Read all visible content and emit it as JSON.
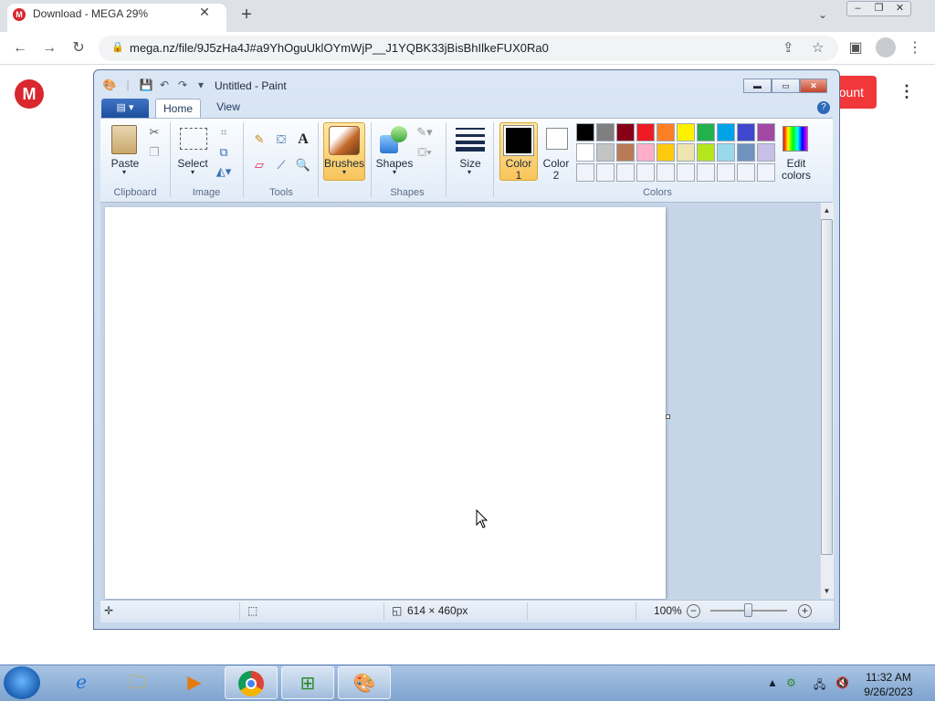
{
  "browser": {
    "tab_title": "Download - MEGA 29%",
    "favicon_letter": "M",
    "tab_close": "✕",
    "new_tab": "+",
    "url": "mega.nz/file/9J5zHa4J#a9YhOguUklOYmWjP__J1YQBK33jBisBhIlkeFUX0Ra0",
    "window_controls": [
      "–",
      "❐",
      "✕"
    ]
  },
  "mega": {
    "logo_letter": "M",
    "account_button": "ount",
    "menu": "⋮",
    "brand_color": "#d9272e"
  },
  "paint": {
    "title": "Untitled - Paint",
    "ribbon_tabs": [
      "Home",
      "View"
    ],
    "groups": {
      "clipboard": "Clipboard",
      "image": "Image",
      "tools": "Tools",
      "shapes": "Shapes",
      "colors": "Colors"
    },
    "buttons": {
      "paste": "Paste",
      "select": "Select",
      "brushes": "Brushes",
      "shapes": "Shapes",
      "size": "Size",
      "color1_a": "Color",
      "color1_b": "1",
      "color2_a": "Color",
      "color2_b": "2",
      "edit_colors_a": "Edit",
      "edit_colors_b": "colors"
    },
    "palette": [
      "#000000",
      "#7f7f7f",
      "#880015",
      "#ed1c24",
      "#ff7f27",
      "#fff200",
      "#22b14c",
      "#00a2e8",
      "#3f48cc",
      "#a349a4",
      "#ffffff",
      "#c3c3c3",
      "#b97a57",
      "#ffaec9",
      "#ffc90e",
      "#efe4b0",
      "#b5e61d",
      "#99d9ea",
      "#7092be",
      "#c8bfe7",
      "#f0f4fa",
      "#f0f4fa",
      "#f0f4fa",
      "#f0f4fa",
      "#f0f4fa",
      "#f0f4fa",
      "#f0f4fa",
      "#f0f4fa",
      "#f0f4fa",
      "#f0f4fa"
    ],
    "status": {
      "image_size": "614 × 460px",
      "zoom": "100%"
    }
  },
  "taskbar": {
    "time": "11:32 AM",
    "date": "9/26/2023"
  }
}
